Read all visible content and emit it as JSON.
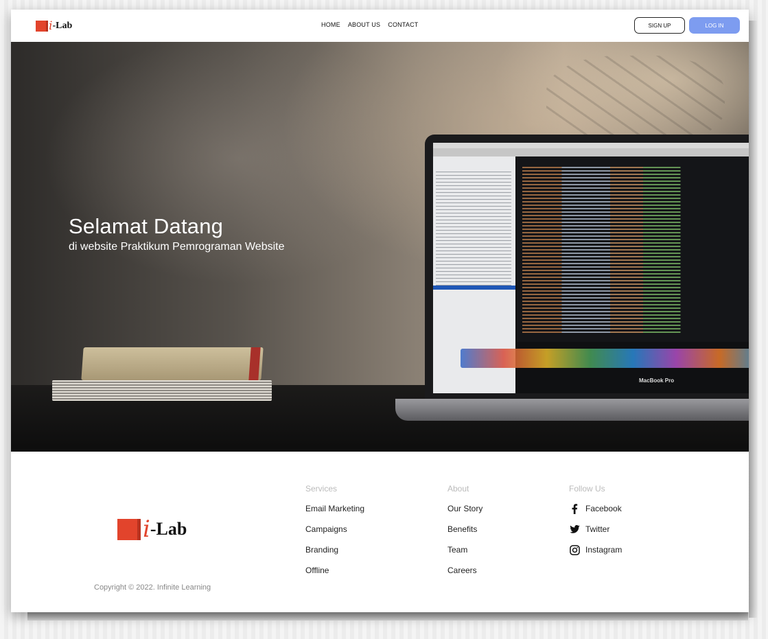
{
  "brand": {
    "logo_text": "-Lab",
    "logo_i": "i"
  },
  "nav": {
    "links": [
      "HOME",
      "ABOUT US",
      "CONTACT"
    ],
    "signup_label": "SIGN UP",
    "login_label": "LOG IN"
  },
  "hero": {
    "title": "Selamat Datang",
    "subtitle": "di website Praktikum Pemrograman  Website",
    "laptop_brand": "MacBook Pro"
  },
  "footer": {
    "services": {
      "heading": "Services",
      "items": [
        "Email Marketing",
        "Campaigns",
        "Branding",
        "Offline"
      ]
    },
    "about": {
      "heading": "About",
      "items": [
        "Our Story",
        "Benefits",
        "Team",
        "Careers"
      ]
    },
    "follow": {
      "heading": "Follow Us",
      "items": [
        {
          "label": "Facebook",
          "icon": "facebook-icon"
        },
        {
          "label": "Twitter",
          "icon": "twitter-icon"
        },
        {
          "label": "Instagram",
          "icon": "instagram-icon"
        }
      ]
    },
    "copyright": "Copyright © 2022. Infinite Learning"
  },
  "colors": {
    "accent": "#e2442c",
    "login_button": "#7d9cf0"
  }
}
